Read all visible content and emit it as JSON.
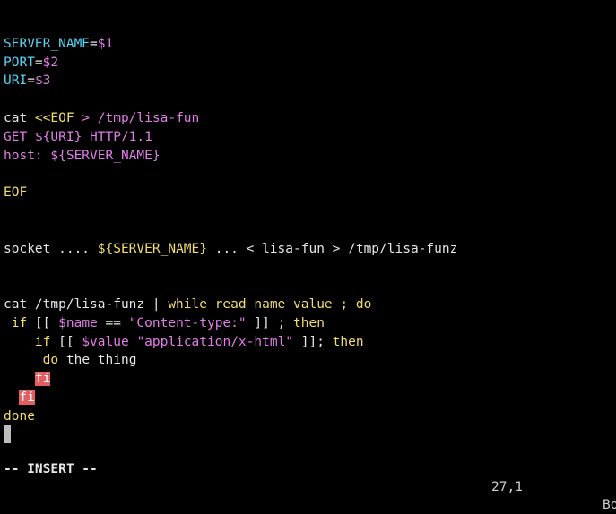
{
  "editor": {
    "lines": [
      {
        "segs": []
      },
      {
        "segs": [
          {
            "t": "SERVER_NAME",
            "c": "var"
          },
          {
            "t": "=",
            "c": "def"
          },
          {
            "t": "$1",
            "c": "str"
          }
        ]
      },
      {
        "segs": [
          {
            "t": "PORT",
            "c": "var"
          },
          {
            "t": "=",
            "c": "def"
          },
          {
            "t": "$2",
            "c": "str"
          }
        ]
      },
      {
        "segs": [
          {
            "t": "URI",
            "c": "var"
          },
          {
            "t": "=",
            "c": "def"
          },
          {
            "t": "$3",
            "c": "str"
          }
        ]
      },
      {
        "segs": []
      },
      {
        "segs": [
          {
            "t": "cat ",
            "c": "def"
          },
          {
            "t": "<<EOF",
            "c": "kw"
          },
          {
            "t": " > /tmp/lisa-fun",
            "c": "str"
          }
        ]
      },
      {
        "segs": [
          {
            "t": "GET ${URI} HTTP/1.1",
            "c": "str"
          }
        ]
      },
      {
        "segs": [
          {
            "t": "host: ${SERVER_NAME}",
            "c": "str"
          }
        ]
      },
      {
        "segs": []
      },
      {
        "segs": [
          {
            "t": "EOF",
            "c": "kw"
          }
        ]
      },
      {
        "segs": []
      },
      {
        "segs": []
      },
      {
        "segs": [
          {
            "t": "socket .... ",
            "c": "def"
          },
          {
            "t": "${SERVER_NAME}",
            "c": "kw"
          },
          {
            "t": " ... < lisa-fun > /tmp/lisa-funz",
            "c": "def"
          }
        ]
      },
      {
        "segs": []
      },
      {
        "segs": []
      },
      {
        "segs": [
          {
            "t": "cat /tmp/lisa-funz | ",
            "c": "def"
          },
          {
            "t": "while read name value ; do",
            "c": "kw"
          }
        ]
      },
      {
        "segs": [
          {
            "t": " ",
            "c": "def"
          },
          {
            "t": "if",
            "c": "kw"
          },
          {
            "t": " [[ ",
            "c": "def"
          },
          {
            "t": "$name",
            "c": "str"
          },
          {
            "t": " == ",
            "c": "def"
          },
          {
            "t": "\"Content-type:\"",
            "c": "str"
          },
          {
            "t": " ]] ; ",
            "c": "def"
          },
          {
            "t": "then",
            "c": "kw"
          }
        ]
      },
      {
        "segs": [
          {
            "t": "    ",
            "c": "def"
          },
          {
            "t": "if",
            "c": "kw"
          },
          {
            "t": " [[ ",
            "c": "def"
          },
          {
            "t": "$value",
            "c": "str"
          },
          {
            "t": " ",
            "c": "def"
          },
          {
            "t": "\"application/x-html\"",
            "c": "str"
          },
          {
            "t": " ]]; ",
            "c": "def"
          },
          {
            "t": "then",
            "c": "kw"
          }
        ]
      },
      {
        "segs": [
          {
            "t": "     ",
            "c": "def"
          },
          {
            "t": "do",
            "c": "kw"
          },
          {
            "t": " the thing",
            "c": "def"
          }
        ]
      },
      {
        "segs": [
          {
            "t": "    ",
            "c": "def"
          },
          {
            "t": "fi",
            "c": "err"
          }
        ]
      },
      {
        "segs": [
          {
            "t": "  ",
            "c": "def"
          },
          {
            "t": "fi",
            "c": "err"
          }
        ]
      },
      {
        "segs": [
          {
            "t": "done",
            "c": "kw"
          }
        ]
      }
    ]
  },
  "statusbar": {
    "mode": "-- INSERT --",
    "position": "27,1",
    "scroll": "Bo"
  },
  "colors": {
    "background": "#000000",
    "variable": "#56d4f5",
    "keyword": "#f2dd6b",
    "string": "#e27de8",
    "default": "#e6e6e6",
    "error_bg": "#e45e61"
  }
}
